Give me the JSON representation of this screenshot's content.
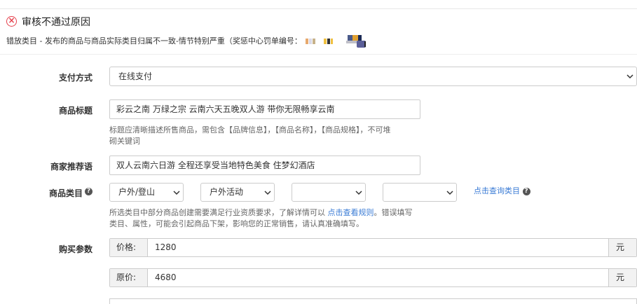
{
  "review": {
    "title": "审核不通过原因",
    "reason": "错放类目 - 发布的商品与商品实际类目归属不一致-情节特别严重（奖惩中心罚单编号："
  },
  "form": {
    "payment": {
      "label": "支付方式",
      "value": "在线支付"
    },
    "title_field": {
      "label": "商品标题",
      "value": "彩云之南 万绿之宗 云南六天五晚双人游 带你无限畅享云南",
      "hint_line1": "标题应清晰描述所售商品，需包含【品牌信息】，【商品名称】，【商品规格】，不可堆",
      "hint_line2": "砌关键词"
    },
    "recommend": {
      "label": "商家推荐语",
      "value": "双人云南六日游 全程还享受当地特色美食 住梦幻酒店"
    },
    "category": {
      "label": "商品类目",
      "selects": [
        "户外/登山",
        "户外活动",
        "",
        ""
      ],
      "query_link": "点击查询类目",
      "hint_prefix": "所选类目中部分商品创建需要满足行业资质要求，了解详情可以",
      "hint_link": "点击查看规则",
      "hint_suffix": "。错误填写",
      "hint_line2": "类目、属性，可能会引起商品下架，影响您的正常销售，请认真准确填写。"
    },
    "purchase": {
      "label": "购买参数",
      "price_label": "价格:",
      "price_value": "1280",
      "original_label": "原价:",
      "original_value": "4680",
      "unit": "元"
    }
  },
  "colors": {
    "accent": "#3a7bd5",
    "error": "#e5404c"
  }
}
